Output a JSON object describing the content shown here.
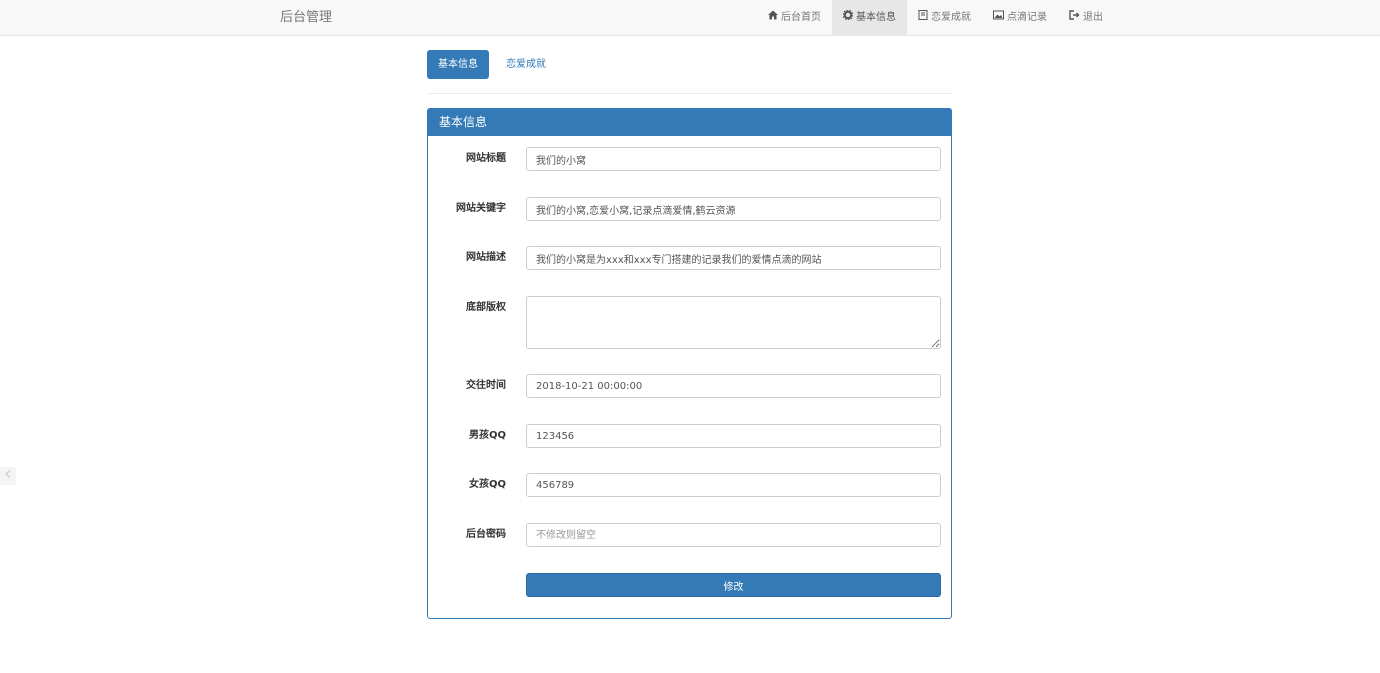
{
  "navbar": {
    "brand": "后台管理",
    "items": [
      {
        "icon": "home-icon",
        "label": "后台首页",
        "active": false
      },
      {
        "icon": "gear-icon",
        "label": "基本信息",
        "active": true
      },
      {
        "icon": "book-icon",
        "label": "恋爱成就",
        "active": false
      },
      {
        "icon": "picture-icon",
        "label": "点滴记录",
        "active": false
      },
      {
        "icon": "logout-icon",
        "label": "退出",
        "active": false
      }
    ]
  },
  "tabs": [
    {
      "label": "基本信息",
      "active": true
    },
    {
      "label": "恋爱成就",
      "active": false
    }
  ],
  "panel": {
    "title": "基本信息",
    "fields": {
      "site_title": {
        "label": "网站标题",
        "value": "我们的小窝"
      },
      "keywords": {
        "label": "网站关键字",
        "value": "我们的小窝,恋爱小窝,记录点滴爱情,鹤云资源"
      },
      "description": {
        "label": "网站描述",
        "value": "我们的小窝是为xxx和xxx专门搭建的记录我们的爱情点滴的网站"
      },
      "copyright": {
        "label": "底部版权",
        "value": ""
      },
      "date": {
        "label": "交往时间",
        "value": "2018-10-21 00:00:00"
      },
      "boy_qq": {
        "label": "男孩QQ",
        "value": "123456"
      },
      "girl_qq": {
        "label": "女孩QQ",
        "value": "456789"
      },
      "password": {
        "label": "后台密码",
        "value": "",
        "placeholder": "不修改则留空"
      }
    },
    "submit_label": "修改"
  },
  "colors": {
    "primary": "#337ab7",
    "navbar_bg": "#f8f8f8",
    "nav_active_bg": "#e7e7e7"
  }
}
